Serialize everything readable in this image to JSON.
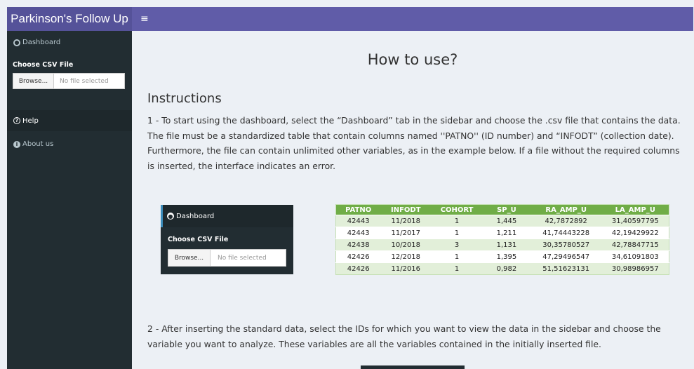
{
  "app": {
    "title": "Parkinson's Follow Up",
    "menu_icon": "hamburger-icon"
  },
  "sidebar": {
    "dashboard_label": "Dashboard",
    "choose_file_label": "Choose CSV File",
    "browse_label": "Browse...",
    "file_status": "No file selected",
    "help_label": "Help",
    "about_label": "About us"
  },
  "main": {
    "title": "How to use?",
    "instructions_heading": "Instructions",
    "paragraph1": "1 - To start using the dashboard, select the “Dashboard” tab in the sidebar and choose the .csv file that contains the data. The file must be a standardized table that contain columns named ''PATNO'' (ID number) and “INFODT” (collection date). Furthermore, the file can contain unlimited other variables, as in the example below. If a file without the required columns is inserted, the interface indicates an error.",
    "paragraph2": "2 - After inserting the standard data, select the IDs for which you want to view the data in the sidebar and choose the variable you want to analyze. These variables are all the variables contained in the initially inserted file."
  },
  "example_sidebar": {
    "dashboard_label": "Dashboard",
    "choose_file_label": "Choose CSV File",
    "browse_label": "Browse...",
    "file_status": "No file selected"
  },
  "example_table": {
    "headers": [
      "PATNO",
      "INFODT",
      "COHORT",
      "SP_U",
      "RA_AMP_U",
      "LA_AMP_U"
    ],
    "rows": [
      [
        "42443",
        "11/2018",
        "1",
        "1,445",
        "42,7872892",
        "31,40597795"
      ],
      [
        "42443",
        "11/2017",
        "1",
        "1,211",
        "41,74443228",
        "42,19429922"
      ],
      [
        "42438",
        "10/2018",
        "3",
        "1,131",
        "30,35780527",
        "42,78847715"
      ],
      [
        "42426",
        "12/2018",
        "1",
        "1,395",
        "47,29496547",
        "34,61091803"
      ],
      [
        "42426",
        "11/2016",
        "1",
        "0,982",
        "51,51623131",
        "30,98986957"
      ]
    ]
  },
  "colors": {
    "header_bar": "#605ca8",
    "logo_bg": "#555299",
    "sidebar_bg": "#222d32",
    "table_header": "#70ad47",
    "table_stripe": "#e2efd9"
  }
}
